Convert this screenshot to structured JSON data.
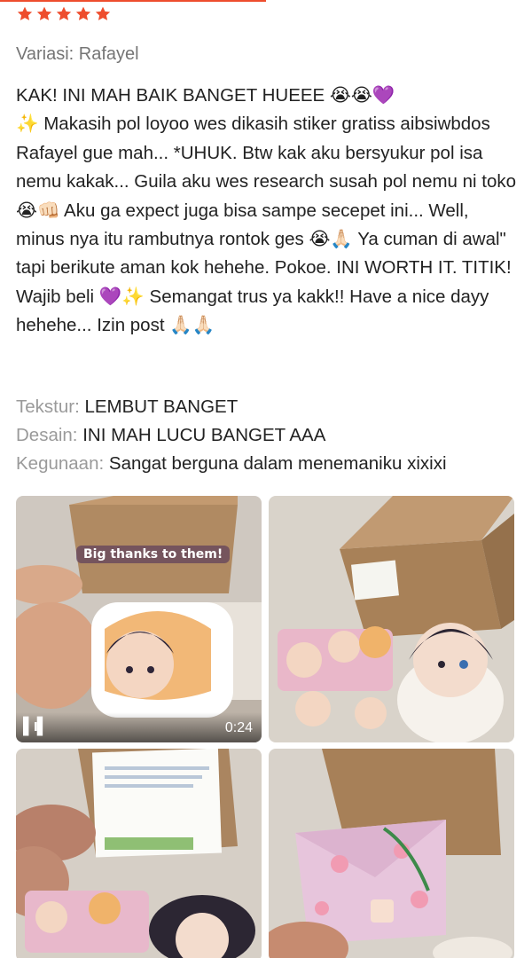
{
  "rating": {
    "stars": 5,
    "max": 5,
    "color": "#ee4d2d"
  },
  "variation": "Variasi: Rafayel",
  "review_text": "KAK! INI MAH BAIK BANGET HUEEE 😭😭💜\n✨ Makasih pol loyoo wes dikasih stiker gratiss aibsiwbdos Rafayel gue mah... *UHUK. Btw kak aku bersyukur pol isa nemu kakak... Guila aku wes research susah pol nemu ni toko 😭👊🏻 Aku ga expect juga bisa sampe secepet ini... Well, minus nya itu rambutnya rontok ges 😭🙏🏻 Ya cuman di awal\" tapi berikute aman kok hehehe. Pokoe. INI WORTH IT. TITIK! Wajib beli 💜✨ Semangat trus ya kakk!! Have a nice dayy hehehe... Izin post 🙏🏻🙏🏻",
  "attributes": [
    {
      "key": "Tekstur:",
      "value": "LEMBUT BANGET"
    },
    {
      "key": "Desain:",
      "value": "INI MAH LUCU BANGET AAA"
    },
    {
      "key": "Kegunaan:",
      "value": "Sangat berguna dalam menemaniku xixixi"
    }
  ],
  "media": {
    "video_caption": "Big thanks to them!",
    "video_duration": "0:24"
  }
}
